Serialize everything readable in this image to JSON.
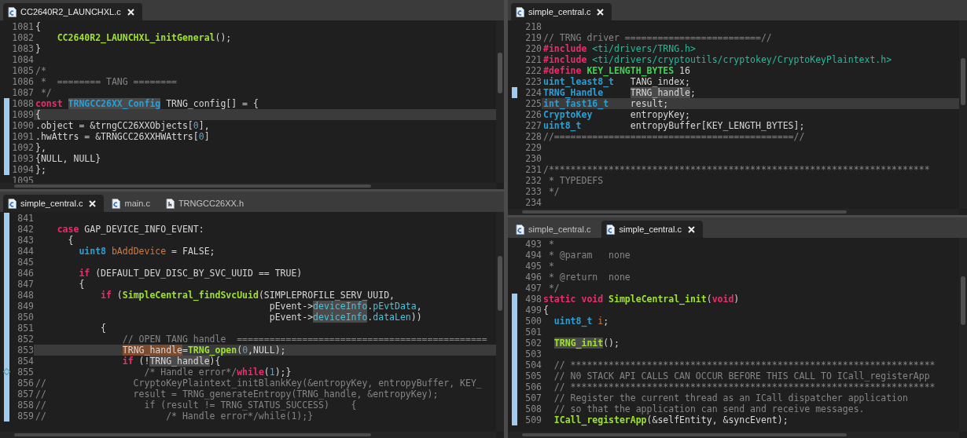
{
  "left_column": [
    {
      "tabs": [
        {
          "label": "CC2640R2_LAUNCHXL.c",
          "kind": "c",
          "selected": true
        }
      ],
      "lines": [
        {
          "number": "1081",
          "changed": false,
          "current": false,
          "tokens": [
            {
              "kind": "plain",
              "text": "{"
            }
          ]
        },
        {
          "number": "1082",
          "changed": false,
          "current": false,
          "tokens": [
            {
              "kind": "function",
              "text": "    CC2640R2_LAUNCHXL_initGeneral"
            },
            {
              "kind": "plain",
              "text": "();"
            }
          ]
        },
        {
          "number": "1083",
          "changed": false,
          "current": false,
          "tokens": [
            {
              "kind": "plain",
              "text": "}"
            }
          ]
        },
        {
          "number": "1084",
          "changed": false,
          "current": false
        },
        {
          "number": "1085",
          "changed": false,
          "current": false,
          "tokens": [
            {
              "kind": "comment",
              "text": "/*"
            }
          ]
        },
        {
          "number": "1086",
          "changed": false,
          "current": false,
          "tokens": [
            {
              "kind": "comment",
              "text": " *  ======== TANG ========"
            }
          ]
        },
        {
          "number": "1087",
          "changed": false,
          "current": false,
          "tokens": [
            {
              "kind": "comment",
              "text": " */"
            }
          ]
        },
        {
          "number": "1088",
          "changed": true,
          "current": false,
          "tokens": [
            {
              "kind": "keyword",
              "text": "const "
            },
            {
              "kind": "type",
              "text": "TRNGCC26XX_Config",
              "highlighted": true
            },
            {
              "kind": "plain",
              "text": " TRNG_config[] = {"
            }
          ]
        },
        {
          "number": "1089",
          "changed": true,
          "current": true,
          "tokens": [
            {
              "kind": "plain",
              "text": "{"
            }
          ]
        },
        {
          "number": "1090",
          "changed": true,
          "current": false,
          "tokens": [
            {
              "kind": "plain",
              "text": ".object = &trngCC26XXObjects["
            },
            {
              "kind": "number",
              "text": "0"
            },
            {
              "kind": "plain",
              "text": "],"
            }
          ]
        },
        {
          "number": "1091",
          "changed": true,
          "current": false,
          "tokens": [
            {
              "kind": "plain",
              "text": ".hwAttrs = &TRNGCC26XXHWAttrs["
            },
            {
              "kind": "number",
              "text": "0"
            },
            {
              "kind": "plain",
              "text": "]"
            }
          ]
        },
        {
          "number": "1092",
          "changed": true,
          "current": false,
          "tokens": [
            {
              "kind": "plain",
              "text": "},"
            }
          ]
        },
        {
          "number": "1093",
          "changed": true,
          "current": false,
          "tokens": [
            {
              "kind": "plain",
              "text": "{NULL, NULL}"
            }
          ]
        },
        {
          "number": "1094",
          "changed": true,
          "current": false,
          "tokens": [
            {
              "kind": "plain",
              "text": "};"
            }
          ]
        },
        {
          "number": "1095",
          "changed": false,
          "current": false
        }
      ]
    },
    {
      "tabs": [
        {
          "label": "simple_central.c",
          "kind": "c",
          "selected": true
        },
        {
          "label": "main.c",
          "kind": "c",
          "selected": false
        },
        {
          "label": "TRNGCC26XX.h",
          "kind": "h",
          "selected": false
        }
      ],
      "lines": [
        {
          "number": "841",
          "changed": true,
          "current": false
        },
        {
          "number": "842",
          "changed": true,
          "current": false,
          "tokens": [
            {
              "kind": "keyword",
              "text": "    case"
            },
            {
              "kind": "plain",
              "text": " GAP_DEVICE_INFO_EVENT:"
            }
          ]
        },
        {
          "number": "843",
          "changed": true,
          "current": false,
          "tokens": [
            {
              "kind": "plain",
              "text": "      {"
            }
          ]
        },
        {
          "number": "844",
          "changed": true,
          "current": false,
          "tokens": [
            {
              "kind": "type",
              "text": "        uint8 "
            },
            {
              "kind": "local",
              "text": "bAddDevice"
            },
            {
              "kind": "plain",
              "text": " = FALSE;"
            }
          ]
        },
        {
          "number": "845",
          "changed": true,
          "current": false
        },
        {
          "number": "846",
          "changed": true,
          "current": false,
          "tokens": [
            {
              "kind": "keyword",
              "text": "        if"
            },
            {
              "kind": "plain",
              "text": " (DEFAULT_DEV_DISC_BY_SVC_UUID == TRUE)"
            }
          ]
        },
        {
          "number": "847",
          "changed": true,
          "current": false,
          "tokens": [
            {
              "kind": "plain",
              "text": "        {"
            }
          ]
        },
        {
          "number": "848",
          "changed": true,
          "current": false,
          "tokens": [
            {
              "kind": "keyword",
              "text": "            if"
            },
            {
              "kind": "plain",
              "text": " ("
            },
            {
              "kind": "function",
              "text": "SimpleCentral_findSvcUuid"
            },
            {
              "kind": "plain",
              "text": "(SIMPLEPROFILE_SERV_UUID,"
            }
          ]
        },
        {
          "number": "849",
          "changed": true,
          "current": false,
          "tokens": [
            {
              "kind": "plain",
              "text": "                                           pEvent->"
            },
            {
              "kind": "field",
              "text": "deviceInfo",
              "highlighted": true
            },
            {
              "kind": "plain",
              "text": "."
            },
            {
              "kind": "field",
              "text": "pEvtData"
            },
            {
              "kind": "plain",
              "text": ","
            }
          ]
        },
        {
          "number": "850",
          "changed": true,
          "current": false,
          "tokens": [
            {
              "kind": "plain",
              "text": "                                           pEvent->"
            },
            {
              "kind": "field",
              "text": "deviceInfo",
              "highlighted": true
            },
            {
              "kind": "plain",
              "text": "."
            },
            {
              "kind": "field",
              "text": "dataLen"
            },
            {
              "kind": "plain",
              "text": "))"
            }
          ]
        },
        {
          "number": "851",
          "changed": true,
          "current": false,
          "tokens": [
            {
              "kind": "plain",
              "text": "            {"
            }
          ]
        },
        {
          "number": "852",
          "changed": true,
          "current": false,
          "tokens": [
            {
              "kind": "comment",
              "text": "                // OPEN TANG handle  =============================================="
            }
          ]
        },
        {
          "number": "853",
          "changed": true,
          "current": true,
          "tokens": [
            {
              "kind": "plain",
              "text": "                TRNG_handle",
              "highlighted": true,
              "write_access": true
            },
            {
              "kind": "plain",
              "text": "="
            },
            {
              "kind": "function",
              "text": "TRNG_open"
            },
            {
              "kind": "plain",
              "text": "("
            },
            {
              "kind": "number",
              "text": "0"
            },
            {
              "kind": "plain",
              "text": ",NULL);"
            }
          ]
        },
        {
          "number": "854",
          "changed": true,
          "current": false,
          "tokens": [
            {
              "kind": "keyword",
              "text": "                if"
            },
            {
              "kind": "plain",
              "text": " (!"
            },
            {
              "kind": "plain",
              "text": "TRNG_handle",
              "highlighted": true
            },
            {
              "kind": "plain",
              "text": "){"
            }
          ]
        },
        {
          "number": "855",
          "changed": true,
          "current": false,
          "marker": true,
          "tokens": [
            {
              "kind": "comment",
              "text": "                    /* Handle error*/"
            },
            {
              "kind": "keyword",
              "text": "while"
            },
            {
              "kind": "plain",
              "text": "("
            },
            {
              "kind": "number",
              "text": "1"
            },
            {
              "kind": "plain",
              "text": ");}"
            }
          ]
        },
        {
          "number": "856",
          "changed": true,
          "current": false,
          "tokens": [
            {
              "kind": "comment",
              "text": "//                CryptoKeyPlaintext_initBlankKey(&entropyKey, entropyBuffer, KEY_"
            }
          ]
        },
        {
          "number": "857",
          "changed": true,
          "current": false,
          "tokens": [
            {
              "kind": "comment",
              "text": "//                result = TRNG_generateEntropy(TRNG_handle, &entropyKey);"
            }
          ]
        },
        {
          "number": "858",
          "changed": true,
          "current": false,
          "tokens": [
            {
              "kind": "comment",
              "text": "//                  if (result != TRNG_STATUS_SUCCESS)    {"
            }
          ]
        },
        {
          "number": "859",
          "changed": true,
          "current": false,
          "tokens": [
            {
              "kind": "comment",
              "text": "//                      /* Handle error*/while(1);}"
            }
          ]
        }
      ]
    }
  ],
  "right_column": [
    {
      "tabs": [
        {
          "label": "simple_central.c",
          "kind": "c",
          "selected": true
        }
      ],
      "lines": [
        {
          "number": "218",
          "changed": false,
          "current": false
        },
        {
          "number": "219",
          "changed": false,
          "current": false,
          "tokens": [
            {
              "kind": "comment",
              "text": "// TRNG driver =========================//"
            }
          ]
        },
        {
          "number": "220",
          "changed": false,
          "current": false,
          "tokens": [
            {
              "kind": "keyword",
              "text": "#include "
            },
            {
              "kind": "string",
              "text": "<ti/drivers/TRNG.h>"
            }
          ]
        },
        {
          "number": "221",
          "changed": false,
          "current": false,
          "tokens": [
            {
              "kind": "keyword",
              "text": "#include "
            },
            {
              "kind": "string",
              "text": "<ti/drivers/cryptoutils/cryptokey/CryptoKeyPlaintext.h>"
            }
          ]
        },
        {
          "number": "222",
          "changed": false,
          "current": false,
          "tokens": [
            {
              "kind": "keyword",
              "text": "#define "
            },
            {
              "kind": "macro",
              "text": "KEY_LENGTH_BYTES"
            },
            {
              "kind": "plain",
              "text": " 16"
            }
          ]
        },
        {
          "number": "223",
          "changed": false,
          "current": false,
          "tokens": [
            {
              "kind": "type",
              "text": "uint_least8_t"
            },
            {
              "kind": "plain",
              "text": "   TANG_index;"
            }
          ]
        },
        {
          "number": "224",
          "changed": true,
          "current": false,
          "tokens": [
            {
              "kind": "type",
              "text": "TRNG_Handle     "
            },
            {
              "kind": "plain",
              "text": "TRNG_handle",
              "highlighted": true
            },
            {
              "kind": "plain",
              "text": ";"
            }
          ]
        },
        {
          "number": "225",
          "changed": false,
          "current": true,
          "tokens": [
            {
              "kind": "type",
              "text": "int_fast16_t"
            },
            {
              "kind": "plain",
              "text": "    result;"
            }
          ]
        },
        {
          "number": "226",
          "changed": false,
          "current": false,
          "tokens": [
            {
              "kind": "type",
              "text": "CryptoKey"
            },
            {
              "kind": "plain",
              "text": "       entropyKey;"
            }
          ]
        },
        {
          "number": "227",
          "changed": false,
          "current": false,
          "tokens": [
            {
              "kind": "type",
              "text": "uint8_t"
            },
            {
              "kind": "plain",
              "text": "         entropyBuffer[KEY_LENGTH_BYTES];"
            }
          ]
        },
        {
          "number": "228",
          "changed": false,
          "current": false,
          "tokens": [
            {
              "kind": "comment",
              "text": "//============================================//"
            }
          ]
        },
        {
          "number": "229",
          "changed": false,
          "current": false
        },
        {
          "number": "230",
          "changed": false,
          "current": false
        },
        {
          "number": "231",
          "changed": false,
          "current": false,
          "tokens": [
            {
              "kind": "comment",
              "text": "/**********************************************************************"
            }
          ]
        },
        {
          "number": "232",
          "changed": false,
          "current": false,
          "tokens": [
            {
              "kind": "comment",
              "text": " * TYPEDEFS"
            }
          ]
        },
        {
          "number": "233",
          "changed": false,
          "current": false,
          "tokens": [
            {
              "kind": "comment",
              "text": " */"
            }
          ]
        },
        {
          "number": "234",
          "changed": false,
          "current": false
        }
      ]
    },
    {
      "tabs": [
        {
          "label": "simple_central.c",
          "kind": "c",
          "selected": false
        },
        {
          "label": "simple_central.c",
          "kind": "c",
          "selected": true
        }
      ],
      "lines": [
        {
          "number": "493",
          "changed": false,
          "current": false,
          "tokens": [
            {
              "kind": "comment",
              "text": " *"
            }
          ]
        },
        {
          "number": "494",
          "changed": false,
          "current": false,
          "tokens": [
            {
              "kind": "comment",
              "text": " * @param   none"
            }
          ]
        },
        {
          "number": "495",
          "changed": false,
          "current": false,
          "tokens": [
            {
              "kind": "comment",
              "text": " *"
            }
          ]
        },
        {
          "number": "496",
          "changed": false,
          "current": false,
          "tokens": [
            {
              "kind": "comment",
              "text": " * @return  none"
            }
          ]
        },
        {
          "number": "497",
          "changed": false,
          "current": false,
          "tokens": [
            {
              "kind": "comment",
              "text": " */"
            }
          ]
        },
        {
          "number": "498",
          "changed": true,
          "current": false,
          "tokens": [
            {
              "kind": "keyword",
              "text": "static void "
            },
            {
              "kind": "function",
              "text": "SimpleCentral_init"
            },
            {
              "kind": "plain",
              "text": "("
            },
            {
              "kind": "keyword",
              "text": "void"
            },
            {
              "kind": "plain",
              "text": ")"
            }
          ]
        },
        {
          "number": "499",
          "changed": true,
          "current": false,
          "tokens": [
            {
              "kind": "plain",
              "text": "{"
            }
          ]
        },
        {
          "number": "500",
          "changed": true,
          "current": false,
          "tokens": [
            {
              "kind": "type",
              "text": "  uint8_t "
            },
            {
              "kind": "local",
              "text": "i"
            },
            {
              "kind": "plain",
              "text": ";"
            }
          ]
        },
        {
          "number": "501",
          "changed": true,
          "current": false
        },
        {
          "number": "502",
          "changed": true,
          "current": false,
          "tokens": [
            {
              "kind": "function",
              "text": "  TRNG_init",
              "highlighted": true
            },
            {
              "kind": "plain",
              "text": "();"
            }
          ]
        },
        {
          "number": "503",
          "changed": true,
          "current": false
        },
        {
          "number": "504",
          "changed": true,
          "current": false,
          "tokens": [
            {
              "kind": "comment",
              "text": "  // *******************************************************************"
            }
          ]
        },
        {
          "number": "505",
          "changed": true,
          "current": false,
          "tokens": [
            {
              "kind": "comment",
              "text": "  // N0 STACK API CALLS CAN OCCUR BEFORE THIS CALL TO ICall_registerApp"
            }
          ]
        },
        {
          "number": "506",
          "changed": true,
          "current": false,
          "tokens": [
            {
              "kind": "comment",
              "text": "  // *******************************************************************"
            }
          ]
        },
        {
          "number": "507",
          "changed": true,
          "current": false,
          "tokens": [
            {
              "kind": "comment",
              "text": "  // Register the current thread as an ICall dispatcher application"
            }
          ]
        },
        {
          "number": "508",
          "changed": true,
          "current": false,
          "tokens": [
            {
              "kind": "comment",
              "text": "  // so that the application can send and receive messages."
            }
          ]
        },
        {
          "number": "509",
          "changed": true,
          "current": false,
          "tokens": [
            {
              "kind": "function",
              "text": "  ICall_registerApp"
            },
            {
              "kind": "plain",
              "text": "(&selfEntity, &syncEvent);"
            }
          ]
        }
      ]
    }
  ]
}
